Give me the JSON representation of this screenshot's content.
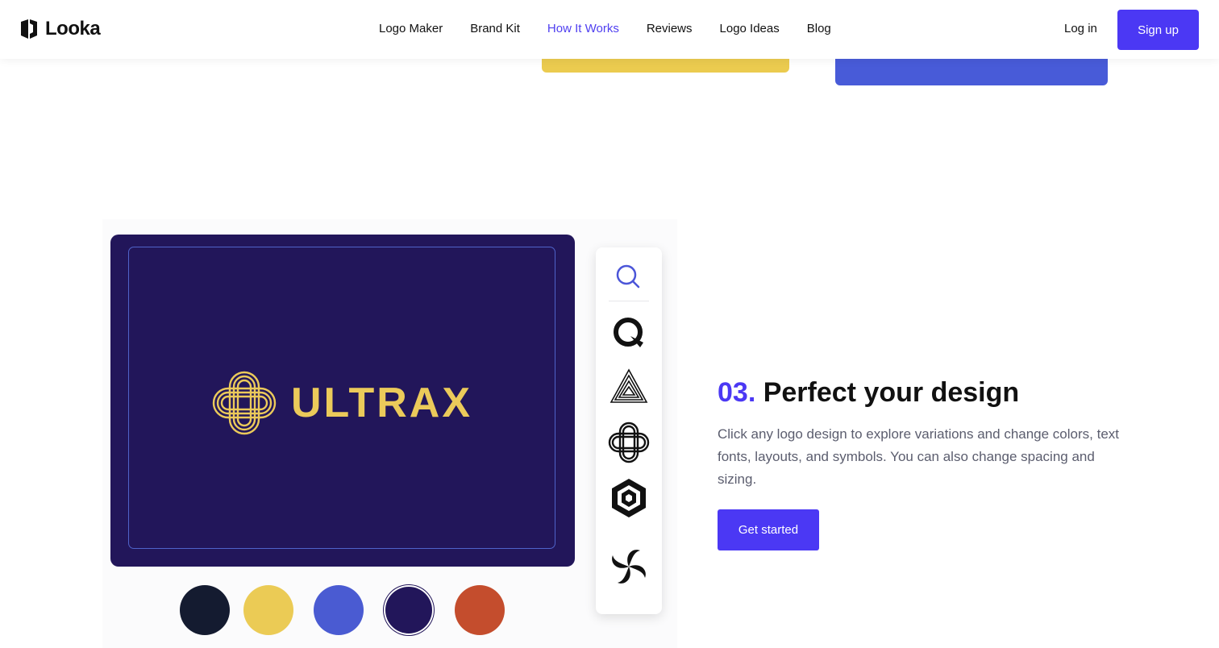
{
  "brand": {
    "name": "Looka"
  },
  "nav": {
    "items": [
      {
        "label": "Logo Maker"
      },
      {
        "label": "Brand Kit"
      },
      {
        "label": "How It Works"
      },
      {
        "label": "Reviews"
      },
      {
        "label": "Logo Ideas"
      },
      {
        "label": "Blog"
      }
    ],
    "active_index": 2,
    "login_label": "Log in",
    "signup_label": "Sign up"
  },
  "demo": {
    "logo_text": "ULTRAX",
    "canvas_color": "#22165a",
    "logo_color": "#ebca5a",
    "swatches": [
      {
        "color": "#141b30"
      },
      {
        "color": "#ebcb55"
      },
      {
        "color": "#4a5bd2"
      },
      {
        "color": "#22165a",
        "selected": true
      },
      {
        "color": "#c44d2d"
      }
    ],
    "panel_icons": [
      "search-icon",
      "q-symbol-icon",
      "triangle-stripes-icon",
      "knot-symbol-icon",
      "hexagon-symbol-icon",
      "swirl-symbol-icon"
    ]
  },
  "section": {
    "step": "03.",
    "title": "Perfect your design",
    "body": "Click any logo design to explore variations and change colors, text fonts, layouts, and symbols. You can also change spacing and sizing.",
    "cta_label": "Get started"
  },
  "colors": {
    "accent": "#4b38f4",
    "yellow": "#ebcb4f",
    "blue": "#485bd8"
  }
}
